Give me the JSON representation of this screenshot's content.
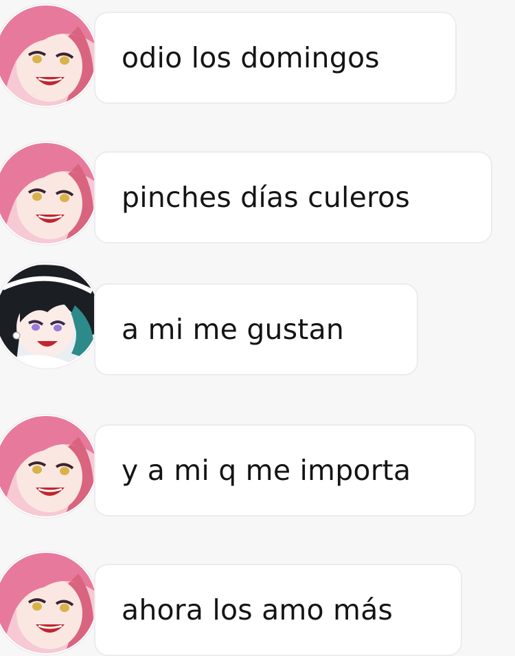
{
  "conversation": {
    "messages": [
      {
        "sender_avatar": "pink-hair-avatar",
        "text": "odio los domingos"
      },
      {
        "sender_avatar": "pink-hair-avatar",
        "text": "pinches días culeros"
      },
      {
        "sender_avatar": "black-teal-hair-avatar",
        "text": "a mi me gustan"
      },
      {
        "sender_avatar": "pink-hair-avatar",
        "text": "y a mi q me importa"
      },
      {
        "sender_avatar": "pink-hair-avatar",
        "text": "ahora los amo  más"
      }
    ]
  },
  "colors": {
    "background": "#f7f7f8",
    "bubble": "#ffffff",
    "bubble_border": "#ececee",
    "text": "#141414",
    "pink_hair": "#e77a9c",
    "dark_hair": "#1b1f24",
    "teal_hair": "#2c8a8a"
  }
}
